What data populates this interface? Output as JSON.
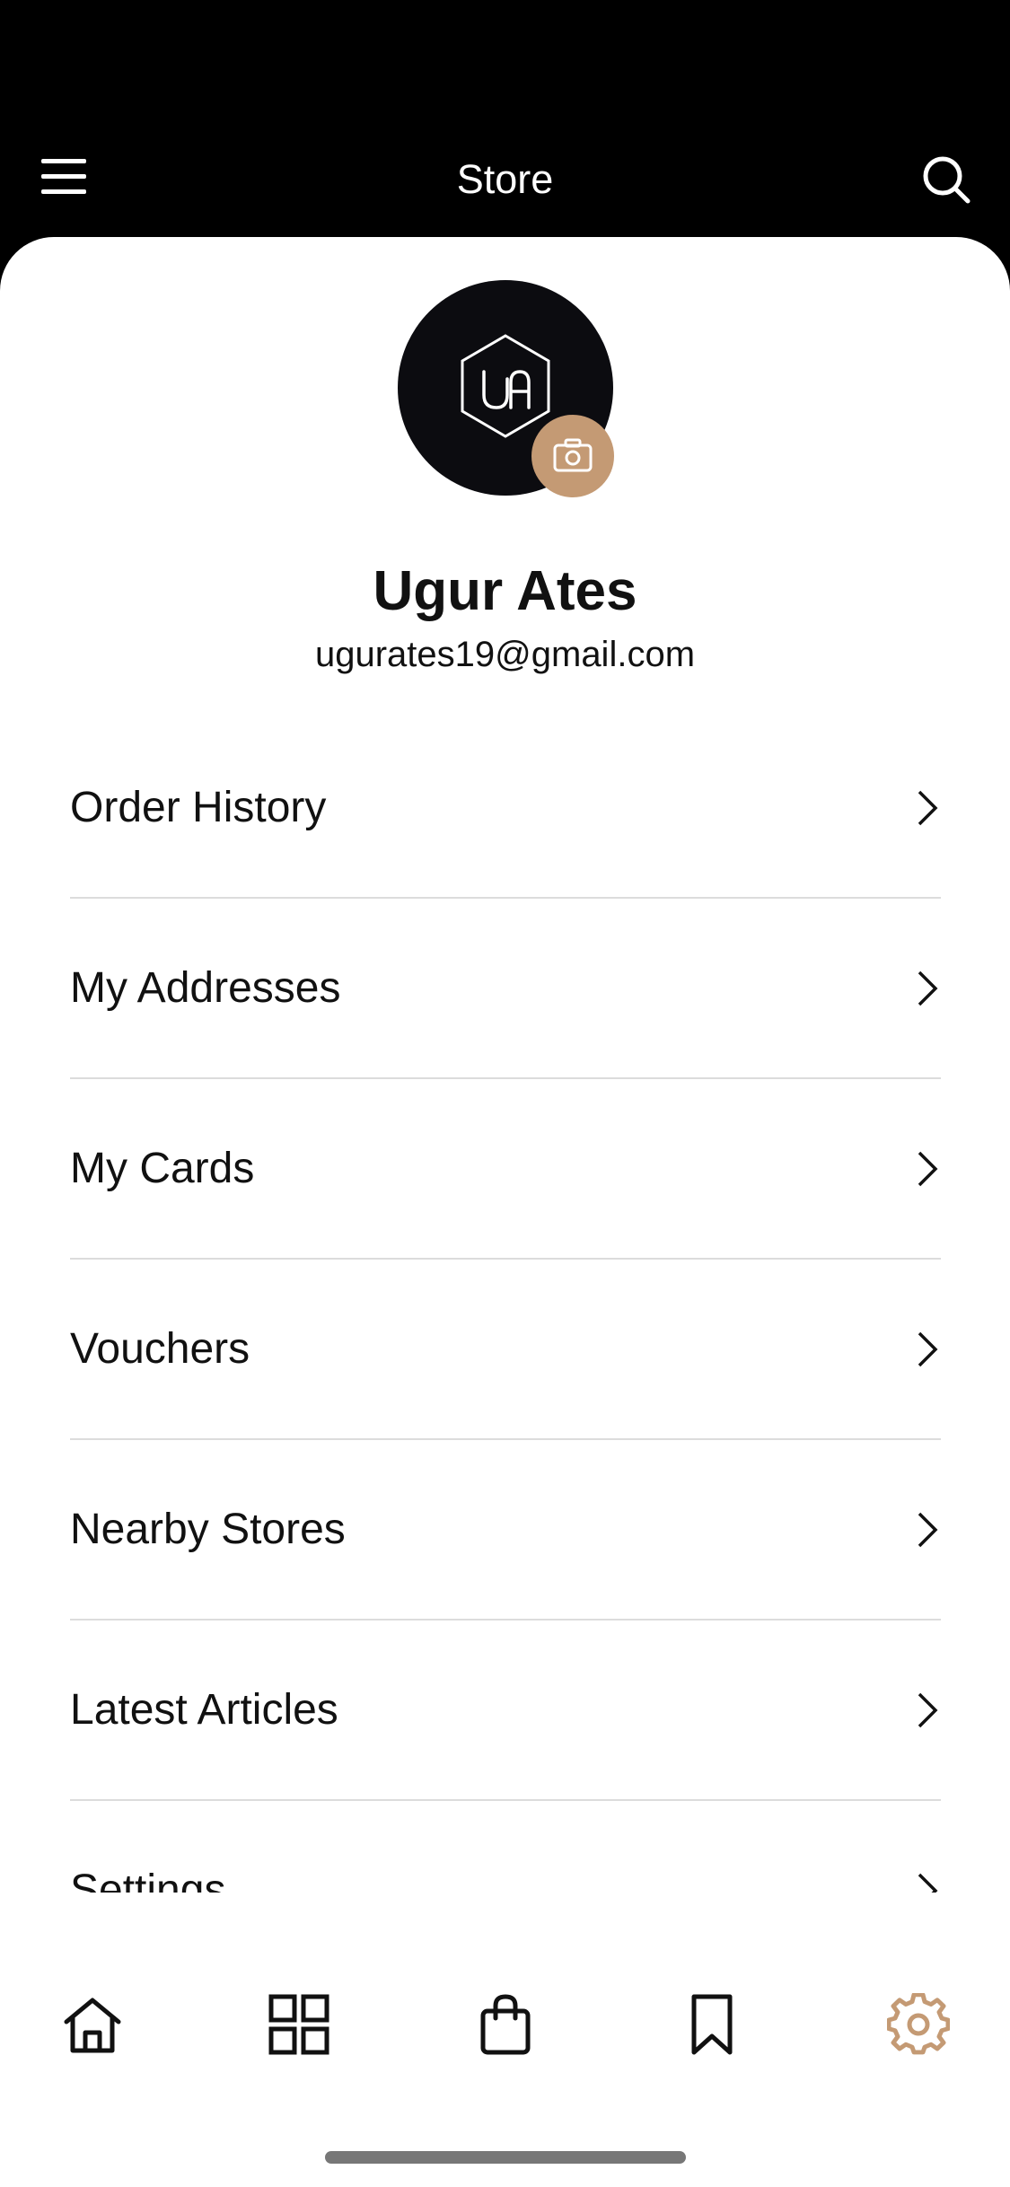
{
  "header": {
    "title": "Store",
    "menu_icon": "hamburger-menu-icon",
    "search_icon": "search-icon"
  },
  "profile": {
    "name": "Ugur Ates",
    "email": "ugurates19@gmail.com",
    "avatar_logo": "ua-hexagon-logo",
    "camera_icon": "camera-icon"
  },
  "menu": {
    "items": [
      {
        "label": "Order History"
      },
      {
        "label": "My Addresses"
      },
      {
        "label": "My Cards"
      },
      {
        "label": "Vouchers"
      },
      {
        "label": "Nearby Stores"
      },
      {
        "label": "Latest Articles"
      },
      {
        "label": "Settings"
      }
    ],
    "chevron_icon": "chevron-right-icon"
  },
  "tabs": {
    "items": [
      "home-icon",
      "grid-icon",
      "shopping-bag-icon",
      "bookmark-icon",
      "gear-icon"
    ],
    "active": "gear-icon"
  },
  "colors": {
    "accent": "#c49a74",
    "header_bg": "#000000",
    "text": "#111111"
  }
}
